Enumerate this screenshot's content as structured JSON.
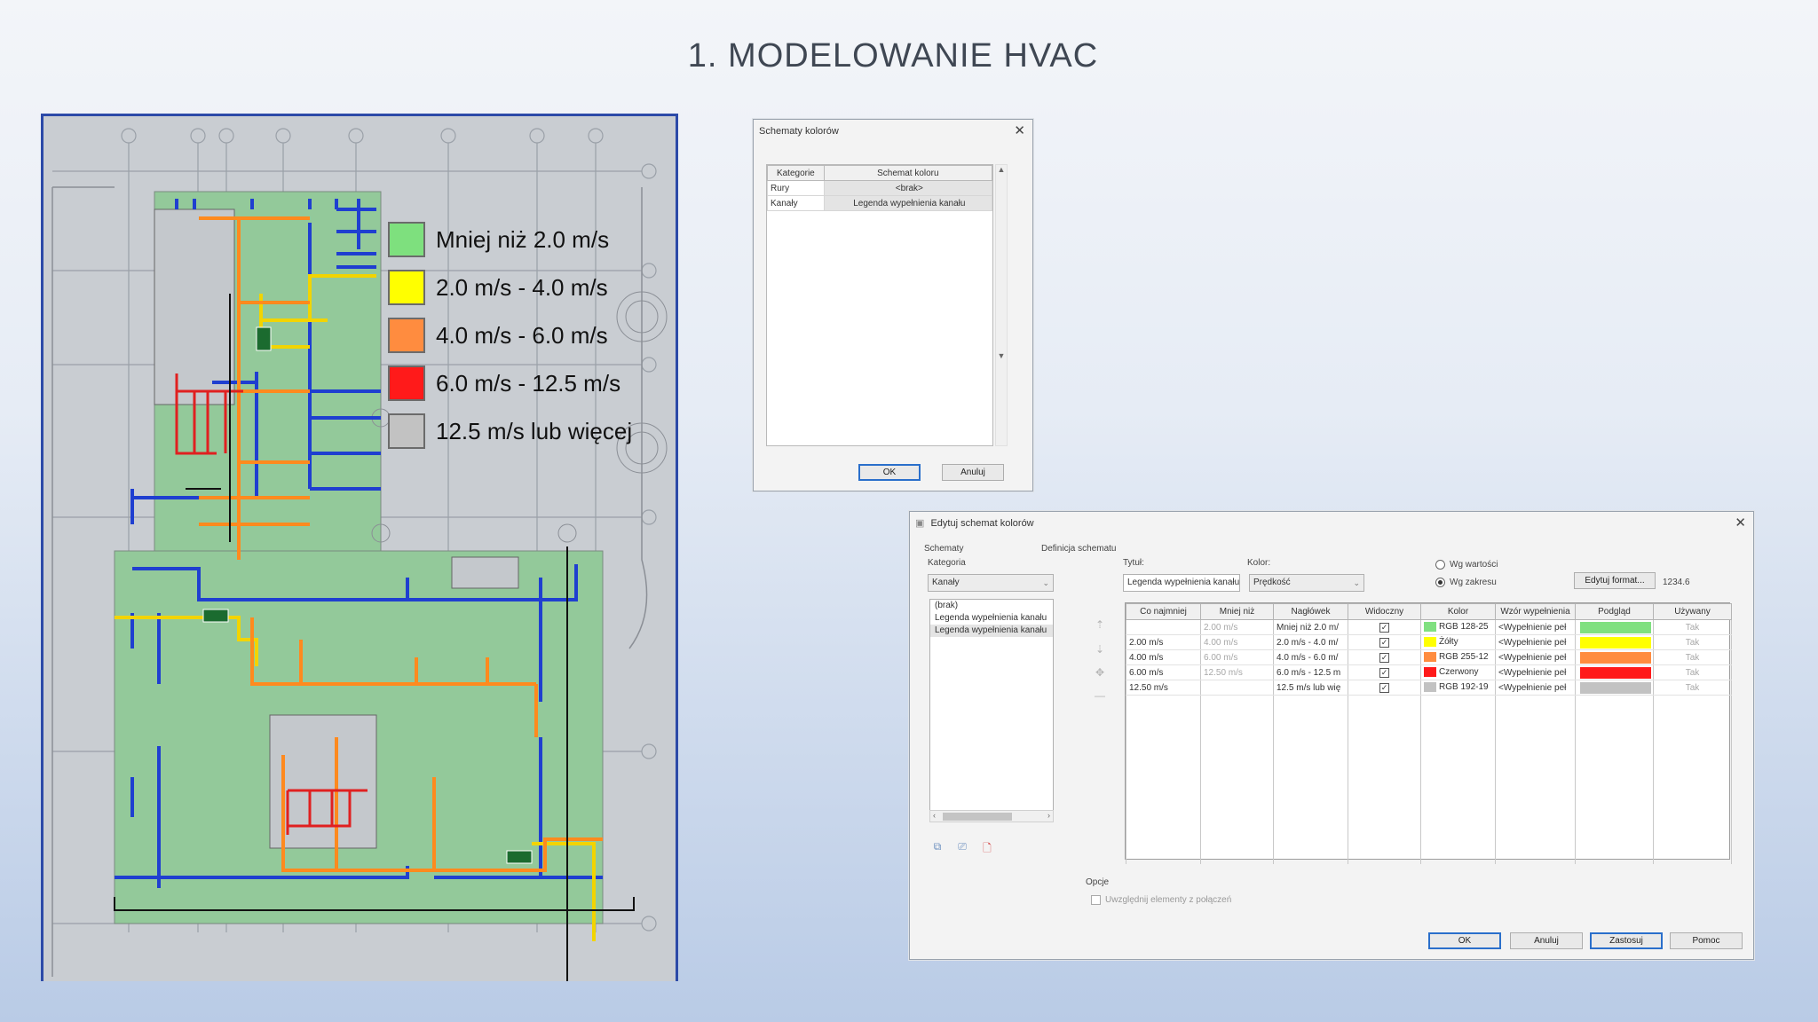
{
  "slide": {
    "title": "1. MODELOWANIE HVAC"
  },
  "legend": [
    {
      "label": "Mniej niż 2.0 m/s",
      "color": "#7ee07e"
    },
    {
      "label": "2.0 m/s - 4.0 m/s",
      "color": "#ffff00"
    },
    {
      "label": "4.0 m/s - 6.0 m/s",
      "color": "#ff8c3f"
    },
    {
      "label": "6.0 m/s - 12.5 m/s",
      "color": "#ff1a1a"
    },
    {
      "label": "12.5 m/s lub więcej",
      "color": "#c2c2c2"
    }
  ],
  "plan_colors": {
    "floor": "#93c99a",
    "duct_blue": "#1f3fd0",
    "duct_yellow": "#f2d400",
    "duct_orange": "#ff8a1e",
    "duct_red": "#e02020"
  },
  "dialog1": {
    "title": "Schematy kolorów",
    "columns": [
      "Kategorie",
      "Schemat koloru"
    ],
    "rows": [
      {
        "category": "Rury",
        "scheme": "<brak>"
      },
      {
        "category": "Kanały",
        "scheme": "Legenda wypełnienia kanału"
      }
    ],
    "ok_label": "OK",
    "cancel_label": "Anuluj"
  },
  "dialog2": {
    "title": "Edytuj schemat kolorów",
    "schemes_label": "Schematy",
    "category_label": "Kategoria",
    "category_value": "Kanały",
    "scheme_list": [
      "(brak)",
      "Legenda wypełnienia kanału",
      "Legenda wypełnienia kanału"
    ],
    "definition_label": "Definicja schematu",
    "title_label": "Tytuł:",
    "title_value": "Legenda wypełnienia kanału",
    "color_label": "Kolor:",
    "color_value": "Prędkość",
    "radio_by_value": "Wg wartości",
    "radio_by_range": "Wg zakresu",
    "edit_format_label": "Edytuj format...",
    "format_sample": "1234.6",
    "columns": [
      "Co najmniej",
      "Mniej niż",
      "Nagłówek",
      "Widoczny",
      "Kolor",
      "Wzór wypełnienia",
      "Podgląd",
      "Używany"
    ],
    "rows": [
      {
        "at_least": "",
        "less_than": "2.00 m/s",
        "header": "Mniej niż 2.0 m/",
        "visible": "✓",
        "color_name": "RGB 128-25",
        "swatch": "#80e080",
        "fill": "<Wypełnienie peł",
        "used": "Tak"
      },
      {
        "at_least": "2.00 m/s",
        "less_than": "4.00 m/s",
        "header": "2.0 m/s - 4.0 m/",
        "visible": "✓",
        "color_name": "Żółty",
        "swatch": "#ffff00",
        "fill": "<Wypełnienie peł",
        "used": "Tak"
      },
      {
        "at_least": "4.00 m/s",
        "less_than": "6.00 m/s",
        "header": "4.0 m/s - 6.0 m/",
        "visible": "✓",
        "color_name": "RGB 255-12",
        "swatch": "#ff8c3f",
        "fill": "<Wypełnienie peł",
        "used": "Tak"
      },
      {
        "at_least": "6.00 m/s",
        "less_than": "12.50 m/s",
        "header": "6.0 m/s - 12.5 m",
        "visible": "✓",
        "color_name": "Czerwony",
        "swatch": "#ff1a1a",
        "fill": "<Wypełnienie peł",
        "used": "Tak"
      },
      {
        "at_least": "12.50 m/s",
        "less_than": "",
        "header": "12.5 m/s lub wię",
        "visible": "✓",
        "color_name": "RGB 192-19",
        "swatch": "#c2c2c2",
        "fill": "<Wypełnienie peł",
        "used": "Tak"
      }
    ],
    "options_label": "Opcje",
    "include_links_label": "Uwzględnij elementy z połączeń",
    "ok_label": "OK",
    "cancel_label": "Anuluj",
    "apply_label": "Zastosuj",
    "help_label": "Pomoc"
  }
}
